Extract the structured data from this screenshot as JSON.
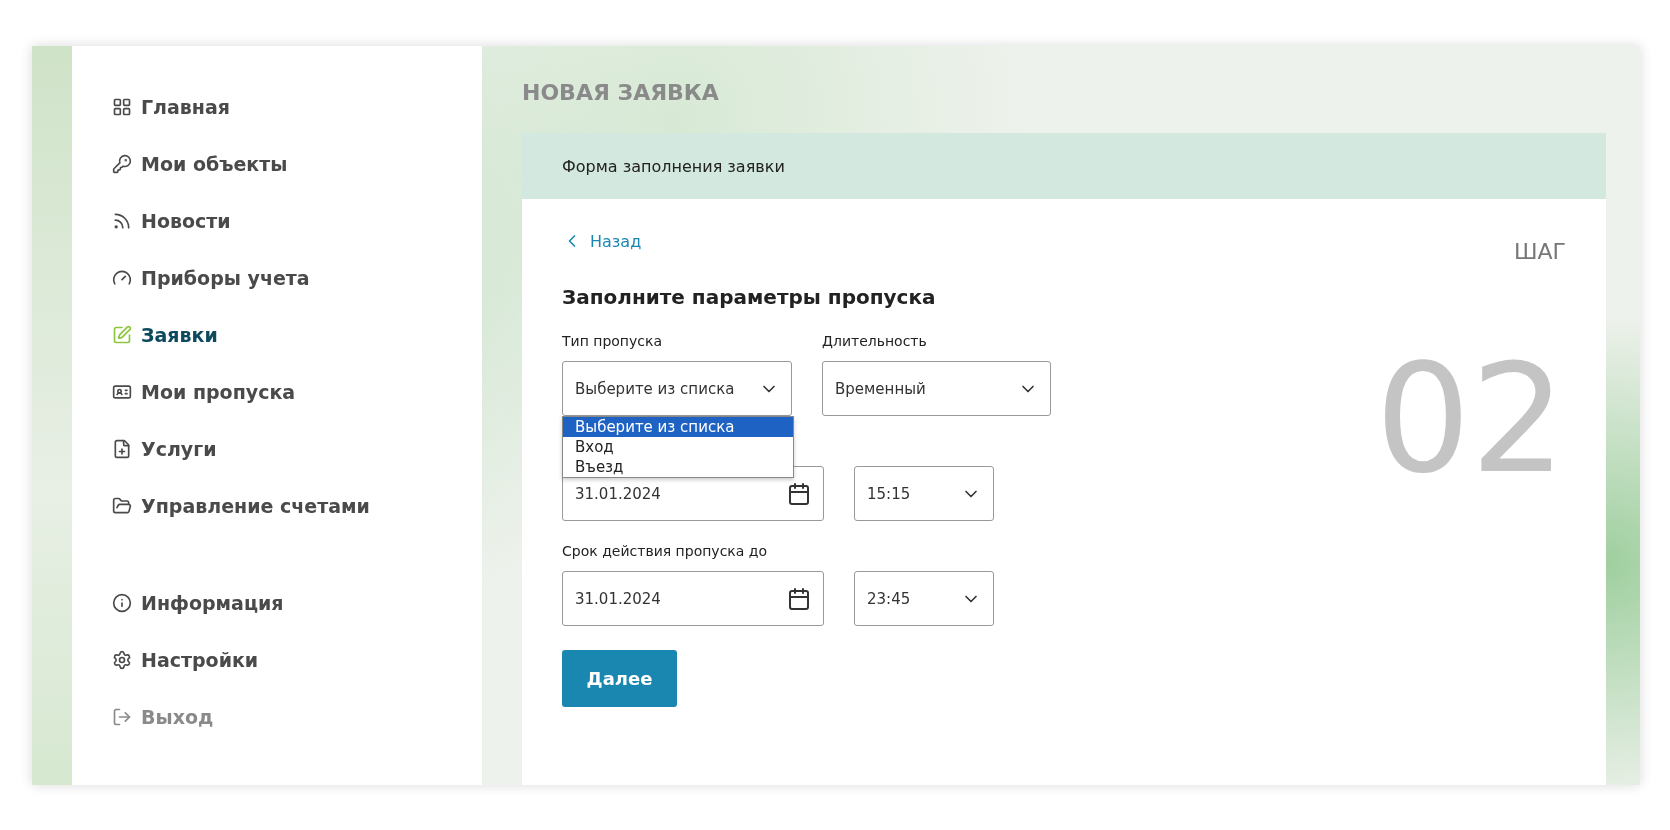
{
  "sidebar": {
    "items": [
      {
        "label": "Главная",
        "selected": false,
        "kind": "nav"
      },
      {
        "label": "Мои объекты",
        "selected": false,
        "kind": "nav"
      },
      {
        "label": "Новости",
        "selected": false,
        "kind": "nav"
      },
      {
        "label": "Приборы учета",
        "selected": false,
        "kind": "nav"
      },
      {
        "label": "Заявки",
        "selected": true,
        "kind": "nav"
      },
      {
        "label": "Мои пропуска",
        "selected": false,
        "kind": "nav"
      },
      {
        "label": "Услуги",
        "selected": false,
        "kind": "nav"
      },
      {
        "label": "Управление счетами",
        "selected": false,
        "kind": "nav"
      }
    ],
    "bottom_items": [
      {
        "label": "Информация",
        "selected": false,
        "kind": "nav"
      },
      {
        "label": "Настройки",
        "selected": false,
        "kind": "nav"
      },
      {
        "label": "Выход",
        "selected": false,
        "kind": "logout"
      }
    ]
  },
  "page_title": "НОВАЯ ЗАЯВКА",
  "card": {
    "header": "Форма заполнения заявки",
    "back_link": "Назад",
    "step_label": "ШАГ",
    "step_number": "02",
    "heading": "Заполните параметры пропуска",
    "pass_type": {
      "label": "Тип пропуска",
      "value": "Выберите из списка",
      "expanded": true,
      "options": [
        {
          "label": "Выберите из списка",
          "selected": true
        },
        {
          "label": "Вход",
          "selected": false
        },
        {
          "label": "Въезд",
          "selected": false
        }
      ]
    },
    "duration": {
      "label": "Длительность",
      "value": "Временный"
    },
    "start": {
      "date": "31.01.2024",
      "time": "15:15"
    },
    "end": {
      "label": "Срок действия пропуска до",
      "date": "31.01.2024",
      "time": "23:45"
    },
    "next_button": "Далее"
  }
}
